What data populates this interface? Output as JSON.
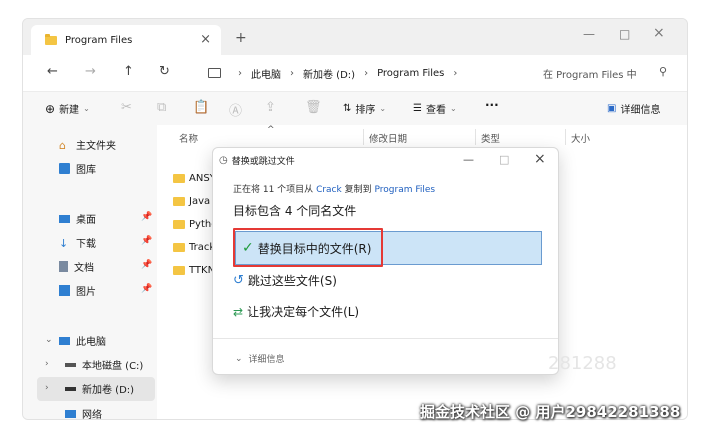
{
  "tab": {
    "title": "Program Files",
    "close": "×",
    "new": "+"
  },
  "window_controls": {
    "minimize": "—",
    "maximize": "□",
    "close": "×"
  },
  "nav": {
    "back": "←",
    "forward": "→",
    "up": "↑",
    "refresh": "↻",
    "breadcrumb": [
      "此电脑",
      "新加卷 (D:)",
      "Program Files"
    ],
    "search_placeholder": "在 Program Files 中"
  },
  "cmdbar": {
    "new": "新建",
    "sort": "排序",
    "view": "查看",
    "more": "···",
    "details": "详细信息"
  },
  "sidebar": {
    "items": [
      {
        "label": "主文件夹"
      },
      {
        "label": "图库"
      },
      {
        "label": "桌面"
      },
      {
        "label": "下载"
      },
      {
        "label": "文档"
      },
      {
        "label": "图片"
      },
      {
        "label": "此电脑"
      },
      {
        "label": "本地磁盘 (C:)"
      },
      {
        "label": "新加卷 (D:)"
      },
      {
        "label": "网络"
      }
    ]
  },
  "columns": {
    "name": "名称",
    "modified": "修改日期",
    "type": "类型",
    "size": "大小"
  },
  "files": [
    "ANSYS",
    "Java",
    "Python",
    "Tracker",
    "TTKN"
  ],
  "dialog": {
    "title": "替换或跳过文件",
    "sub_prefix": "正在将 11 个项目从",
    "sub_src": "Crack",
    "sub_mid": "复制到",
    "sub_dst": "Program Files",
    "heading": "目标包含 4 个同名文件",
    "opt_replace": "替换目标中的文件(R)",
    "opt_skip": "跳过这些文件(S)",
    "opt_decide": "让我决定每个文件(L)",
    "details": "详细信息",
    "ghost": "281288"
  },
  "watermark": "掘金技术社区 @ 用户29842281388"
}
